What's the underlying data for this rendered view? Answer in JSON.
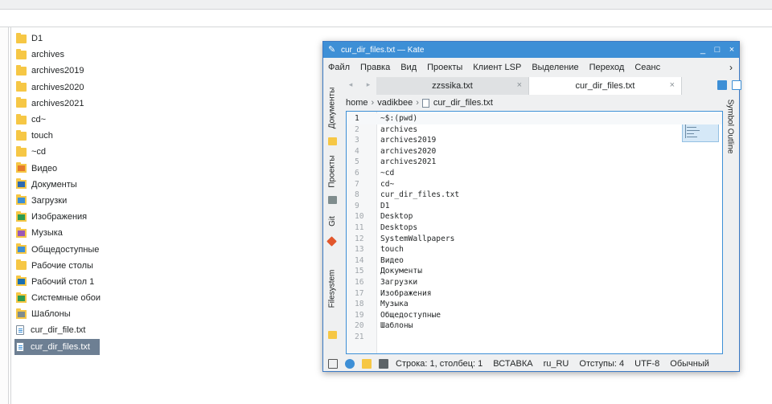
{
  "files": [
    {
      "name": "D1",
      "type": "folder"
    },
    {
      "name": "archives",
      "type": "folder"
    },
    {
      "name": "archives2019",
      "type": "folder"
    },
    {
      "name": "archives2020",
      "type": "folder"
    },
    {
      "name": "archives2021",
      "type": "folder"
    },
    {
      "name": "cd~",
      "type": "folder"
    },
    {
      "name": "touch",
      "type": "folder"
    },
    {
      "name": "~cd",
      "type": "folder"
    },
    {
      "name": "Видео",
      "type": "folder-video"
    },
    {
      "name": "Документы",
      "type": "folder-documents"
    },
    {
      "name": "Загрузки",
      "type": "folder-downloads"
    },
    {
      "name": "Изображения",
      "type": "folder-pictures"
    },
    {
      "name": "Музыка",
      "type": "folder-music"
    },
    {
      "name": "Общедоступные",
      "type": "folder-public"
    },
    {
      "name": "Рабочие столы",
      "type": "folder"
    },
    {
      "name": "Рабочий стол 1",
      "type": "folder-desktop"
    },
    {
      "name": "Системные обои",
      "type": "folder-wallpapers"
    },
    {
      "name": "Шаблоны",
      "type": "folder-templates"
    },
    {
      "name": "cur_dir_file.txt",
      "type": "text-file"
    },
    {
      "name": "cur_dir_files.txt",
      "type": "text-file",
      "selected": true
    }
  ],
  "kate": {
    "title": "cur_dir_files.txt — Kate",
    "window_buttons": [
      "_",
      "□",
      "×"
    ],
    "menu": [
      "Файл",
      "Правка",
      "Вид",
      "Проекты",
      "Клиент LSP",
      "Выделение",
      "Переход",
      "Сеанс"
    ],
    "menu_more": "›",
    "tabs": [
      {
        "label": "zzssika.txt",
        "active": false
      },
      {
        "label": "cur_dir_files.txt",
        "active": true
      }
    ],
    "tab_close": "×",
    "left_panels": [
      "Документы",
      "Проекты",
      "Git",
      "Filesystem"
    ],
    "right_panels": [
      "Symbol Outline"
    ],
    "breadcrumb": [
      "home",
      "vadikbee",
      "cur_dir_files.txt"
    ],
    "lines": [
      "~$:(pwd)",
      "archives",
      "archives2019",
      "archives2020",
      "archives2021",
      "~cd",
      "cd~",
      "cur_dir_files.txt",
      "D1",
      "Desktop",
      "Desktops",
      "SystemWallpapers",
      "touch",
      "Видео",
      "Документы",
      "Загрузки",
      "Изображения",
      "Музыка",
      "Общедоступные",
      "Шаблоны",
      ""
    ],
    "status": {
      "position": "Строка: 1, столбец: 1",
      "mode": "ВСТАВКА",
      "lang": "ru_RU",
      "indent": "Отступы: 4",
      "encoding": "UTF-8",
      "syntax": "Обычный"
    }
  },
  "colors": {
    "accent": "#3d8fd6",
    "folder": "#f6c745",
    "selection": "#6d7f93"
  }
}
